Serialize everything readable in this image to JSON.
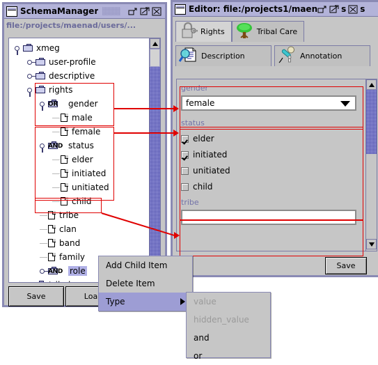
{
  "schema_window": {
    "title": "SchemaManager",
    "icon": "window-icon",
    "controls": {
      "minimize": "minimize-icon",
      "maximize": "maximize-icon",
      "close": "close-icon"
    },
    "path": "file:/projects/maenad/users/...",
    "tree": [
      {
        "label": "xmeg",
        "depth": 0,
        "icon": "folder",
        "toggle": "open",
        "badge": ""
      },
      {
        "label": "user-profile",
        "depth": 1,
        "icon": "folder",
        "toggle": "closed",
        "badge": ""
      },
      {
        "label": "descriptive",
        "depth": 1,
        "icon": "folder",
        "toggle": "closed",
        "badge": ""
      },
      {
        "label": "rights",
        "depth": 1,
        "icon": "folder",
        "toggle": "open",
        "badge": ""
      },
      {
        "label": "gender",
        "depth": 2,
        "icon": "folder",
        "toggle": "open",
        "badge": "OR"
      },
      {
        "label": "male",
        "depth": 3,
        "icon": "doc",
        "toggle": "",
        "badge": ""
      },
      {
        "label": "female",
        "depth": 3,
        "icon": "doc",
        "toggle": "",
        "badge": ""
      },
      {
        "label": "status",
        "depth": 2,
        "icon": "folder",
        "toggle": "open",
        "badge": "AND"
      },
      {
        "label": "elder",
        "depth": 3,
        "icon": "doc",
        "toggle": "",
        "badge": ""
      },
      {
        "label": "initiated",
        "depth": 3,
        "icon": "doc",
        "toggle": "",
        "badge": ""
      },
      {
        "label": "unitiated",
        "depth": 3,
        "icon": "doc",
        "toggle": "",
        "badge": ""
      },
      {
        "label": "child",
        "depth": 3,
        "icon": "doc",
        "toggle": "",
        "badge": ""
      },
      {
        "label": "tribe",
        "depth": 2,
        "icon": "doc",
        "toggle": "",
        "badge": ""
      },
      {
        "label": "clan",
        "depth": 2,
        "icon": "doc",
        "toggle": "",
        "badge": ""
      },
      {
        "label": "band",
        "depth": 2,
        "icon": "doc",
        "toggle": "",
        "badge": ""
      },
      {
        "label": "family",
        "depth": 2,
        "icon": "doc",
        "toggle": "",
        "badge": ""
      },
      {
        "label": "role",
        "depth": 2,
        "icon": "folder",
        "toggle": "closed",
        "badge": "AND",
        "selected": true
      },
      {
        "label": "tribal-care",
        "depth": 1,
        "icon": "folder",
        "toggle": "closed",
        "badge": ""
      }
    ],
    "buttons": {
      "save": "Save",
      "load": "Loa.."
    }
  },
  "editor_window": {
    "title": "Editor: file:/projects1/maen",
    "title_tail": "s",
    "title_tail2": "s",
    "icon": "window-icon",
    "controls": {
      "minimize": "minimize-icon",
      "maximize": "maximize-icon",
      "close": "close-icon"
    },
    "tabs_row1": [
      {
        "label": "Rights",
        "icon": "padlock-icon",
        "active": true
      },
      {
        "label": "Tribal Care",
        "icon": "tree-icon",
        "active": false
      }
    ],
    "tabs_row2": [
      {
        "label": "Description",
        "icon": "magnifier-document-icon",
        "active": false
      },
      {
        "label": "Annotation",
        "icon": "microphone-icon",
        "active": false
      }
    ],
    "fields": {
      "gender": {
        "label": "gender",
        "value": "female",
        "type": "combobox"
      },
      "status": {
        "label": "status",
        "type": "checkbox-group",
        "options": [
          {
            "label": "elder",
            "checked": true
          },
          {
            "label": "initiated",
            "checked": true
          },
          {
            "label": "unitiated",
            "checked": false
          },
          {
            "label": "child",
            "checked": false
          }
        ]
      },
      "tribe": {
        "label": "tribe",
        "value": "",
        "type": "text"
      }
    },
    "save_label": "Save"
  },
  "context_menu": {
    "items": [
      {
        "label": "Add Child Item",
        "highlighted": false,
        "submenu": false
      },
      {
        "label": "Delete Item",
        "highlighted": false,
        "submenu": false
      },
      {
        "label": "Type",
        "highlighted": true,
        "submenu": true
      }
    ]
  },
  "type_submenu": {
    "items": [
      {
        "label": "value",
        "disabled": true
      },
      {
        "label": "hidden_value",
        "disabled": true
      },
      {
        "label": "and",
        "disabled": false
      },
      {
        "label": "or",
        "disabled": false
      }
    ]
  },
  "colors": {
    "title_bar": "#b3b3d9",
    "window_border": "#8a8ab4",
    "panel": "#c6c6c6",
    "annotation_red": "#e00000",
    "field_label": "#7272a8",
    "selection": "#b0b0e6",
    "menu_highlight": "#9d9dd4"
  }
}
